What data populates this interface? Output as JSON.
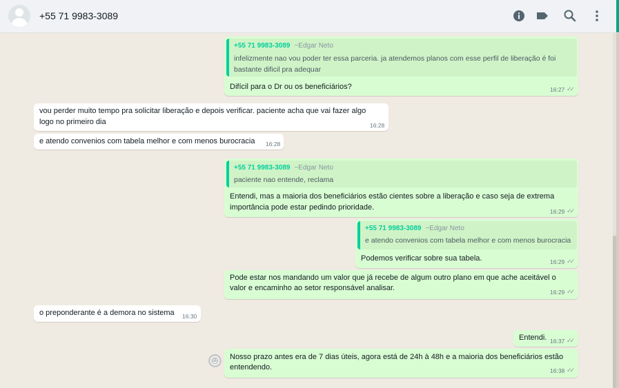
{
  "header": {
    "contact": "+55 71 9983-3089",
    "icons": [
      "info-icon",
      "label-icon",
      "search-icon",
      "menu-icon"
    ]
  },
  "messages": [
    {
      "quote": {
        "name": "+55 71 9983-3089",
        "push": "~Edgar Neto",
        "lines": [
          "infelizmente nao vou poder ter essa parceria. ja atendemos planos com esse perfil de liberação é foi",
          "bastante dificil pra adequar"
        ]
      },
      "text_lines": [
        "Difícil para o Dr ou os beneficiários?"
      ],
      "time": "16:27"
    },
    {
      "text_lines": [
        "vou perder muito tempo pra solicitar liberação e depois verificar. paciente acha que vai fazer algo",
        "logo no primeiro dia"
      ],
      "time": "16:28"
    },
    {
      "text_lines": [
        "e atendo convenios com tabela melhor e com menos burocracia"
      ],
      "time": "16:28"
    },
    {
      "quote": {
        "name": "+55 71 9983-3089",
        "push": "~Edgar Neto",
        "lines": [
          "paciente nao entende, reclama"
        ]
      },
      "text_lines": [
        "Entendi, mas a maioria dos beneficiários estão cientes sobre a liberação e caso seja de extrema",
        "importância pode estar pedindo prioridade."
      ],
      "time": "16:29"
    },
    {
      "quote": {
        "name": "+55 71 9983-3089",
        "push": "~Edgar Neto",
        "lines": [
          "e atendo convenios com tabela melhor e com menos burocracia"
        ]
      },
      "text_lines": [
        "Podemos verificar sobre sua tabela."
      ],
      "time": "16:29"
    },
    {
      "text_lines": [
        "Pode estar nos mandando um valor que já recebe de algum outro plano em que ache aceitável o",
        "valor e encaminho ao setor responsável analisar."
      ],
      "time": "16:29"
    },
    {
      "text_lines": [
        "o preponderante é a demora no sistema"
      ],
      "time": "16:30"
    },
    {
      "text_lines": [
        "Entendi."
      ],
      "time": "16:37"
    },
    {
      "text_lines": [
        "Nosso prazo antes era de 7 dias úteis, agora está de 24h à 48h e a maioria dos beneficiários estão",
        "entendendo."
      ],
      "time": "16:38"
    }
  ],
  "colors": {
    "outgoing": "#d9fdd3",
    "incoming": "#ffffff",
    "quote_accent": "#06cf9c",
    "header_accent": "#00a884"
  }
}
